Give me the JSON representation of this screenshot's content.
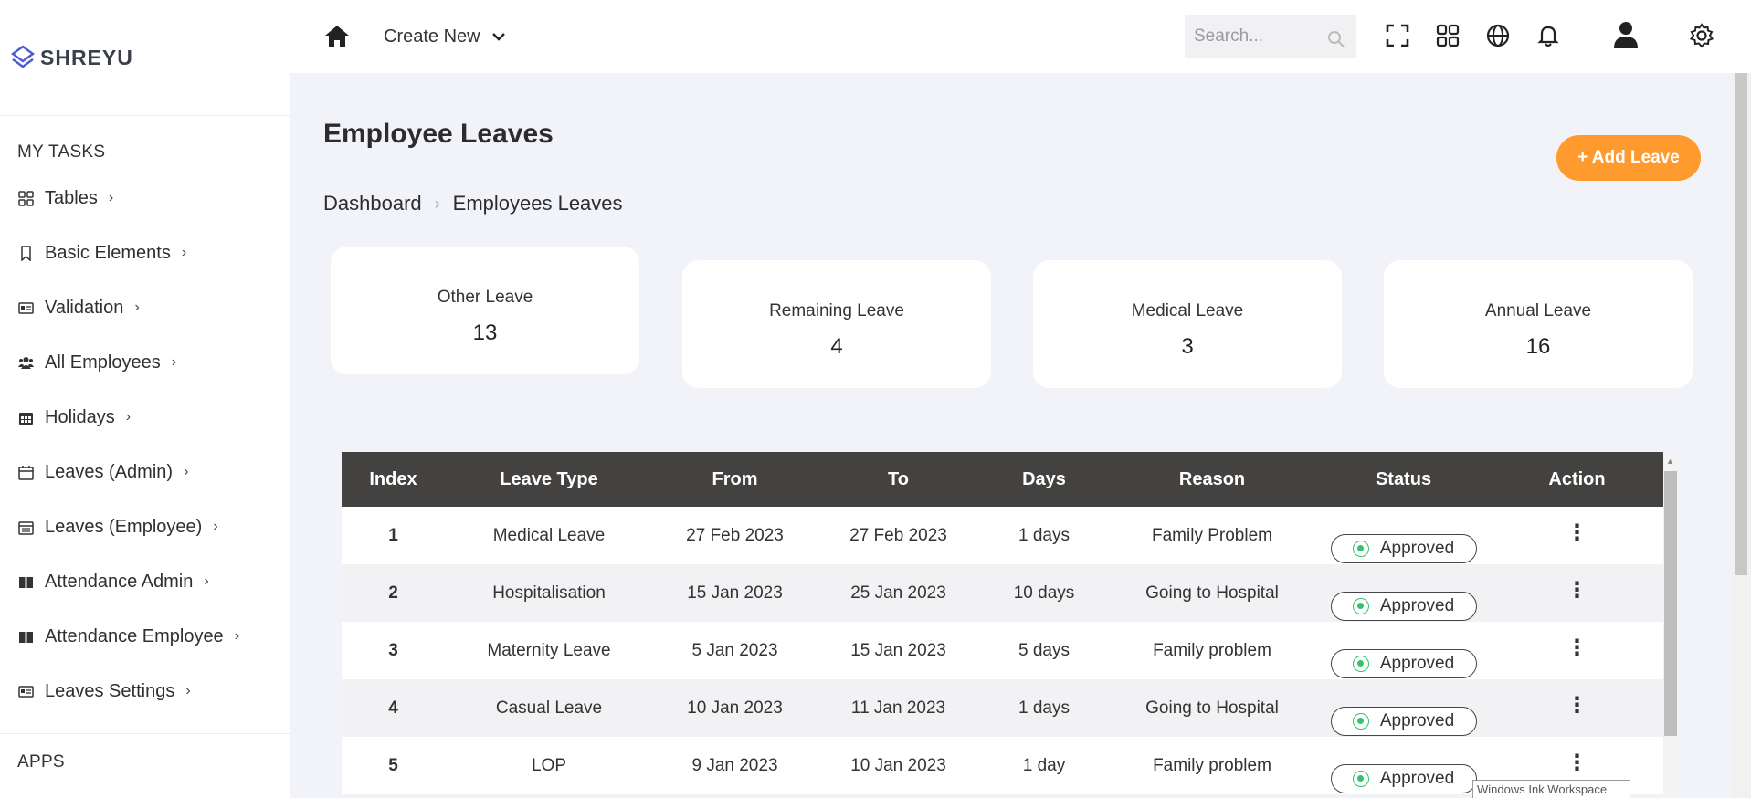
{
  "brand": {
    "name": "SHREYU",
    "accent": "#4a5bd4"
  },
  "sidebar": {
    "tasks_title": "MY TASKS",
    "items": [
      {
        "label": "Tables",
        "icon": "grid-icon"
      },
      {
        "label": "Basic Elements",
        "icon": "bookmark-icon"
      },
      {
        "label": "Validation",
        "icon": "id-card-icon"
      },
      {
        "label": "All Employees",
        "icon": "users-icon"
      },
      {
        "label": "Holidays",
        "icon": "calendar-icon"
      },
      {
        "label": "Leaves (Admin)",
        "icon": "calendar-outline-icon"
      },
      {
        "label": "Leaves (Employee)",
        "icon": "calendar-list-icon"
      },
      {
        "label": "Attendance Admin",
        "icon": "book-icon"
      },
      {
        "label": "Attendance Employee",
        "icon": "book-icon"
      },
      {
        "label": "Leaves Settings",
        "icon": "id-card-icon"
      }
    ],
    "apps_title": "APPS"
  },
  "topbar": {
    "create_new": "Create New",
    "search_placeholder": "Search..."
  },
  "page": {
    "title": "Employee Leaves",
    "add_button": "+ Add Leave",
    "breadcrumb": {
      "root": "Dashboard",
      "current": "Employees Leaves"
    }
  },
  "stats": [
    {
      "label": "Other Leave",
      "value": "13"
    },
    {
      "label": "Remaining Leave",
      "value": "4"
    },
    {
      "label": "Medical Leave",
      "value": "3"
    },
    {
      "label": "Annual Leave",
      "value": "16"
    }
  ],
  "table": {
    "headers": [
      "Index",
      "Leave Type",
      "From",
      "To",
      "Days",
      "Reason",
      "Status",
      "Action"
    ],
    "rows": [
      {
        "index": "1",
        "type": "Medical Leave",
        "from": "27 Feb 2023",
        "to": "27 Feb 2023",
        "days": "1 days",
        "reason": "Family Problem",
        "status": "Approved"
      },
      {
        "index": "2",
        "type": "Hospitalisation",
        "from": "15 Jan 2023",
        "to": "25 Jan 2023",
        "days": "10 days",
        "reason": "Going to Hospital",
        "status": "Approved"
      },
      {
        "index": "3",
        "type": "Maternity Leave",
        "from": "5 Jan 2023",
        "to": "15 Jan 2023",
        "days": "5 days",
        "reason": "Family problem",
        "status": "Approved"
      },
      {
        "index": "4",
        "type": "Casual Leave",
        "from": "10 Jan 2023",
        "to": "11 Jan 2023",
        "days": "1 days",
        "reason": "Going to Hospital",
        "status": "Approved"
      },
      {
        "index": "5",
        "type": "LOP",
        "from": "9 Jan 2023",
        "to": "10 Jan 2023",
        "days": "1 day",
        "reason": "Family problem",
        "status": "Approved"
      }
    ],
    "action_glyph": "⋮"
  },
  "colors": {
    "header_bg": "#434240",
    "add_button": "#ff9a2e",
    "approved": "#32c36c"
  },
  "tooltip": "Windows Ink Workspace"
}
